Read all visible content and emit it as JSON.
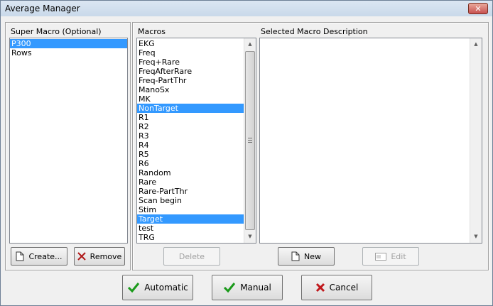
{
  "window": {
    "title": "Average Manager",
    "close_glyph": "✕"
  },
  "super_macro": {
    "label": "Super Macro (Optional)",
    "items": [
      {
        "text": "P300",
        "selected": true
      },
      {
        "text": "Rows",
        "selected": false
      }
    ],
    "create_label": "Create...",
    "remove_label": "Remove"
  },
  "macros": {
    "label": "Macros",
    "items": [
      {
        "text": "EKG",
        "selected": false
      },
      {
        "text": "Freq",
        "selected": false
      },
      {
        "text": "Freq+Rare",
        "selected": false
      },
      {
        "text": "FreqAfterRare",
        "selected": false
      },
      {
        "text": "Freq-PartThr",
        "selected": false
      },
      {
        "text": "ManoSx",
        "selected": false
      },
      {
        "text": "MK",
        "selected": false
      },
      {
        "text": "NonTarget",
        "selected": true
      },
      {
        "text": "R1",
        "selected": false
      },
      {
        "text": "R2",
        "selected": false
      },
      {
        "text": "R3",
        "selected": false
      },
      {
        "text": "R4",
        "selected": false
      },
      {
        "text": "R5",
        "selected": false
      },
      {
        "text": "R6",
        "selected": false
      },
      {
        "text": "Random",
        "selected": false
      },
      {
        "text": "Rare",
        "selected": false
      },
      {
        "text": "Rare-PartThr",
        "selected": false
      },
      {
        "text": "Scan begin",
        "selected": false
      },
      {
        "text": "Stim",
        "selected": false
      },
      {
        "text": "Target",
        "selected": true
      },
      {
        "text": "test",
        "selected": false
      },
      {
        "text": "TRG",
        "selected": false
      }
    ],
    "delete_label": "Delete"
  },
  "description": {
    "label": "Selected Macro Description",
    "new_label": "New",
    "edit_label": "Edit"
  },
  "bottom": {
    "automatic_label": "Automatic",
    "manual_label": "Manual",
    "cancel_label": "Cancel"
  },
  "colors": {
    "selection": "#3399ff",
    "check_green": "#1a9a1a",
    "cancel_red": "#c0181c"
  }
}
